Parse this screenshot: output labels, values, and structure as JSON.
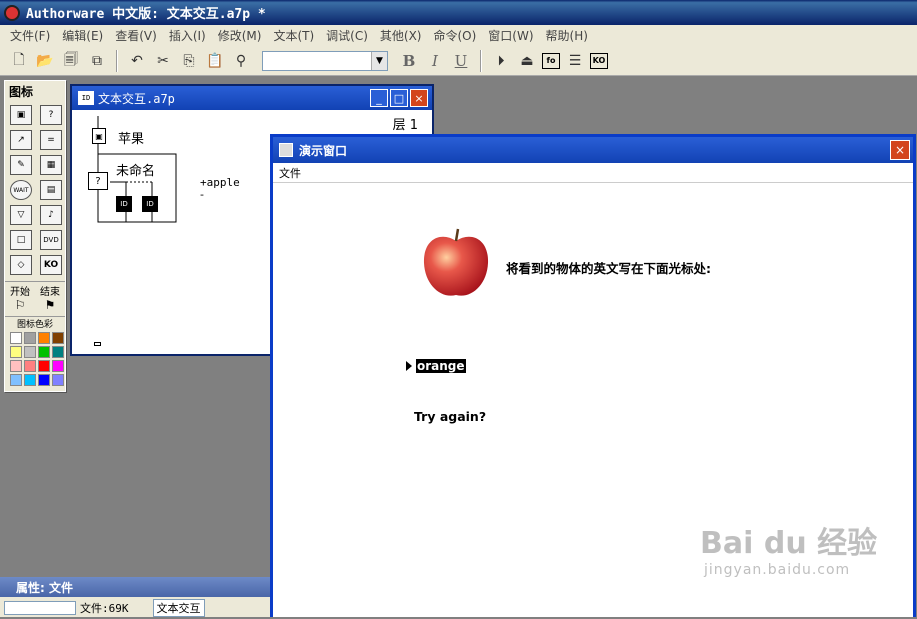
{
  "app": {
    "title": "Authorware 中文版: 文本交互.a7p *"
  },
  "menu": [
    "文件(F)",
    "编辑(E)",
    "查看(V)",
    "插入(I)",
    "修改(M)",
    "文本(T)",
    "调试(C)",
    "其他(X)",
    "命令(O)",
    "窗口(W)",
    "帮助(H)"
  ],
  "toolbar": {
    "font_combo_value": "",
    "bold": "B",
    "italic": "I",
    "underline": "U",
    "fo_label": "fo",
    "ko_label": "KO"
  },
  "palette": {
    "title": "图标",
    "start_label": "开始",
    "end_label": "结束",
    "color_label": "图标色彩",
    "icons": [
      "display-icon",
      "interaction-icon",
      "motion-icon",
      "calculation-icon",
      "erase-icon",
      "map-icon",
      "wait-icon",
      "digital-movie-icon",
      "navigate-icon",
      "sound-icon",
      "framework-icon",
      "dvd-icon",
      "decision-icon",
      "knowledge-object-icon"
    ],
    "icon_glyphs": [
      "▣",
      "?",
      "↗",
      "=",
      "✎",
      "▦",
      "WAIT",
      "▤",
      "▽",
      "♪",
      "□",
      "DVD",
      "◇",
      "KO"
    ],
    "colors": [
      "#ffffff",
      "#a0a0a0",
      "#ff8000",
      "#804000",
      "#ffff80",
      "#c0c0c0",
      "#00c000",
      "#008080",
      "#ffc0c0",
      "#ff8080",
      "#ff0000",
      "#ff00ff",
      "#80c0ff",
      "#00c0ff",
      "#0000ff",
      "#8080ff"
    ]
  },
  "flow": {
    "title": "文本交互.a7p",
    "layer_label": "层 1",
    "icon1_label": "苹果",
    "interaction_label": "未命名",
    "response_label": "+apple",
    "response_minus": "-",
    "min_btn": "_",
    "max_btn": "□",
    "close_btn": "×"
  },
  "present": {
    "title": "演示窗口",
    "menu_file": "文件",
    "question": "将看到的物体的英文写在下面光标处:",
    "answer_value": "orange",
    "feedback": "Try again?",
    "close_btn": "×"
  },
  "props": {
    "title": "属性: 文件",
    "file_size": "文件:69K",
    "file_name": "文本交互"
  },
  "watermark": {
    "brand": "Bai du 经验",
    "url": "jingyan.baidu.com"
  }
}
